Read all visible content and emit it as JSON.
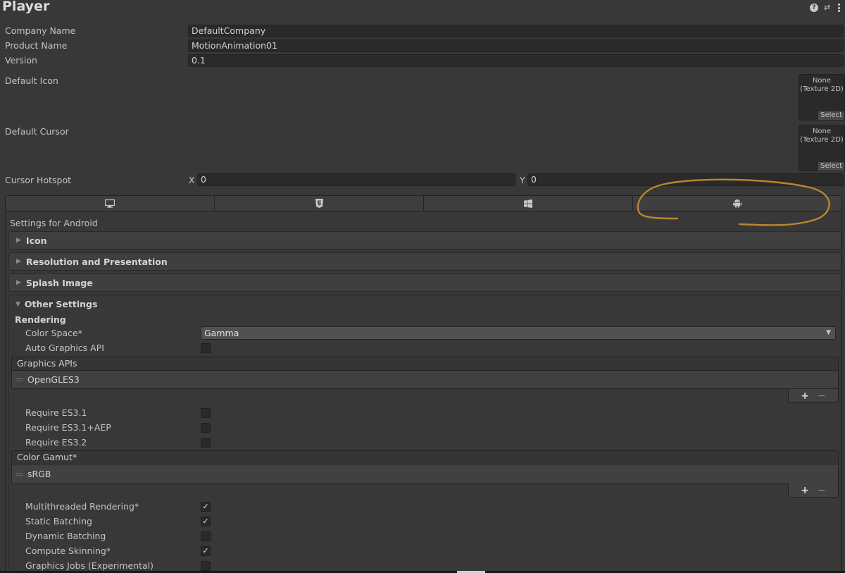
{
  "header": {
    "title": "Player"
  },
  "player": {
    "company_name": {
      "label": "Company Name",
      "value": "DefaultCompany"
    },
    "product_name": {
      "label": "Product Name",
      "value": "MotionAnimation01"
    },
    "version": {
      "label": "Version",
      "value": "0.1"
    },
    "default_icon": {
      "label": "Default Icon",
      "field_line1": "None",
      "field_line2": "(Texture 2D)",
      "select_label": "Select"
    },
    "default_cursor": {
      "label": "Default Cursor",
      "field_line1": "None",
      "field_line2": "(Texture 2D)",
      "select_label": "Select"
    },
    "cursor_hotspot": {
      "label": "Cursor Hotspot",
      "x_label": "X",
      "x_value": "0",
      "y_label": "Y",
      "y_value": "0"
    }
  },
  "platform_tabs": [
    {
      "icon": "monitor-icon",
      "name": "Standalone"
    },
    {
      "icon": "html5-icon",
      "name": "WebGL"
    },
    {
      "icon": "windows-icon",
      "name": "Universal Windows Platform"
    },
    {
      "icon": "android-icon",
      "name": "Android",
      "active": true
    }
  ],
  "settings_heading": "Settings for Android",
  "sections": {
    "icon": "Icon",
    "resolution": "Resolution and Presentation",
    "splash": "Splash Image",
    "other": "Other Settings"
  },
  "other_settings": {
    "rendering_heading": "Rendering",
    "color_space": {
      "label": "Color Space*",
      "value": "Gamma"
    },
    "auto_graphics_api": {
      "label": "Auto Graphics API",
      "checked": false
    },
    "graphics_apis": {
      "header": "Graphics APIs",
      "items": [
        "OpenGLES3"
      ]
    },
    "require_es31": {
      "label": "Require ES3.1",
      "checked": false
    },
    "require_es31_aep": {
      "label": "Require ES3.1+AEP",
      "checked": false
    },
    "require_es32": {
      "label": "Require ES3.2",
      "checked": false
    },
    "color_gamut": {
      "header": "Color Gamut*",
      "items": [
        "sRGB"
      ]
    },
    "multithreaded_rendering": {
      "label": "Multithreaded Rendering*",
      "checked": true
    },
    "static_batching": {
      "label": "Static Batching",
      "checked": true
    },
    "dynamic_batching": {
      "label": "Dynamic Batching",
      "checked": false
    },
    "compute_skinning": {
      "label": "Compute Skinning*",
      "checked": true
    },
    "graphics_jobs": {
      "label": "Graphics Jobs (Experimental)",
      "checked": false
    }
  },
  "list_controls": {
    "add": "+",
    "remove": "−"
  },
  "colors": {
    "background": "#383838",
    "field": "#2a2a2a",
    "annotation": "#b8862b"
  }
}
